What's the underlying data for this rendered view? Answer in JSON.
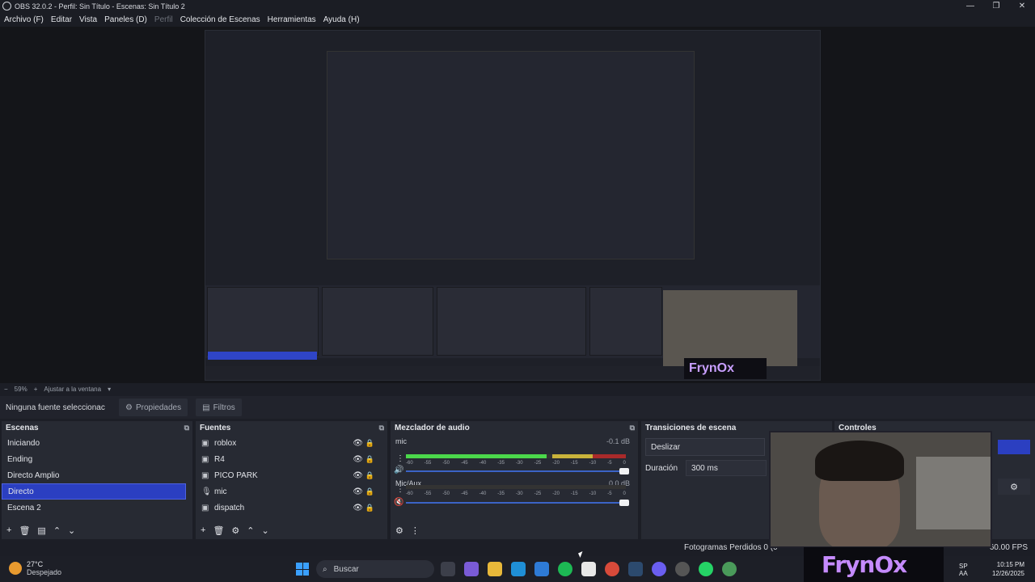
{
  "window": {
    "title": "OBS 32.0.2 - Perfil: Sin Título - Escenas: Sin Título 2",
    "minimize": "—",
    "restore": "❐",
    "close": "✕"
  },
  "menu": {
    "archivo": "Archivo (F)",
    "editar": "Editar",
    "vista": "Vista",
    "paneles": "Paneles (D)",
    "perfil": "Perfil",
    "coleccion": "Colección de Escenas",
    "herramientas": "Herramientas",
    "ayuda": "Ayuda (H)"
  },
  "zoom": {
    "minus": "−",
    "level": "59%",
    "plus": "+",
    "fit": "Ajustar a la ventana"
  },
  "source_bar": {
    "selected": "Ninguna fuente seleccionac",
    "properties": "Propiedades",
    "filters": "Filtros"
  },
  "scenes": {
    "title": "Escenas",
    "items": [
      "Iniciando",
      "Ending",
      "Directo Amplio",
      "Directo",
      "Escena 2"
    ],
    "selected_index": 3
  },
  "sources": {
    "title": "Fuentes",
    "items": [
      {
        "label": "roblox",
        "icon": "monitor-icon"
      },
      {
        "label": "R4",
        "icon": "monitor-icon"
      },
      {
        "label": "PICO PARK",
        "icon": "monitor-icon"
      },
      {
        "label": "mic",
        "icon": "microphone-icon"
      },
      {
        "label": "dispatch",
        "icon": "monitor-icon"
      }
    ]
  },
  "mixer": {
    "title": "Mezclador de audio",
    "channels": [
      {
        "name": "mic",
        "db": "-0.1 dB",
        "level": 0.97
      },
      {
        "name": "Mic/Aux",
        "db": "0.0 dB",
        "level": 0.0
      }
    ],
    "scale": [
      "-60",
      "-55",
      "-50",
      "-45",
      "-40",
      "-35",
      "-30",
      "-25",
      "-20",
      "-15",
      "-10",
      "-5",
      "0"
    ]
  },
  "transitions": {
    "title": "Transiciones de escena",
    "type": "Deslizar",
    "duration_label": "Duración",
    "duration_value": "300 ms"
  },
  "controls": {
    "title": "Controles"
  },
  "status": {
    "dropped": "Fotogramas Perdidos 0 (0",
    "fps": "60.00 FPS"
  },
  "overlay": {
    "brand": "FrynOx"
  },
  "taskbar": {
    "temp": "27°C",
    "weather": "Despejado",
    "search": "Buscar",
    "lang": "SP",
    "lang2": "AA",
    "time": "10:15 PM",
    "date": "12/26/2025"
  },
  "colors": {
    "accent": "#2b3fc1",
    "brand": "#c58bff"
  }
}
